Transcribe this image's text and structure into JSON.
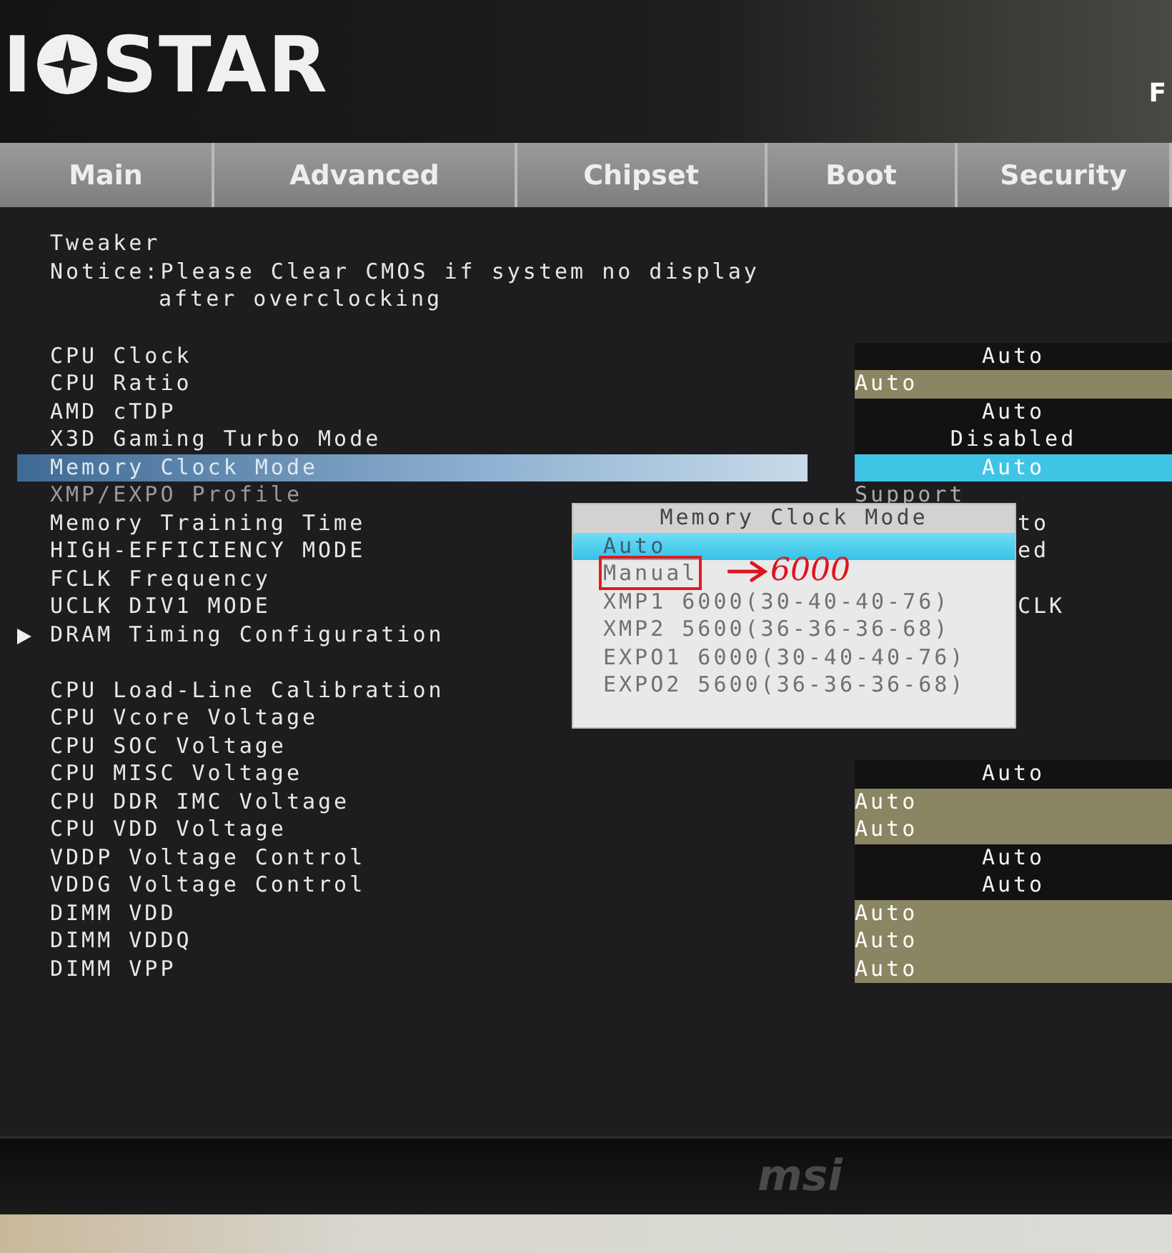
{
  "header": {
    "logo": {
      "before": "I",
      "after": "STAR"
    },
    "model": "F"
  },
  "tabs": [
    {
      "label": "Main",
      "selected": false
    },
    {
      "label": "Advanced",
      "selected": false
    },
    {
      "label": "Chipset",
      "selected": false
    },
    {
      "label": "Boot",
      "selected": false
    },
    {
      "label": "Security",
      "selected": false
    }
  ],
  "page": {
    "title": "Tweaker",
    "notice": "Notice:Please Clear CMOS if system no display",
    "notice_continued": "after overclocking"
  },
  "groups": [
    {
      "rows": [
        {
          "kind": "setting",
          "label": "CPU Clock",
          "selected": false,
          "disabled": false,
          "value": {
            "kind": "select",
            "text": "Auto"
          }
        },
        {
          "kind": "setting",
          "label": "CPU Ratio",
          "selected": false,
          "disabled": false,
          "value": {
            "kind": "input",
            "text": "Auto"
          }
        },
        {
          "kind": "setting",
          "label": "AMD cTDP",
          "selected": false,
          "disabled": false,
          "value": {
            "kind": "select",
            "text": "Auto"
          }
        },
        {
          "kind": "setting",
          "label": "X3D Gaming Turbo Mode",
          "selected": false,
          "disabled": false,
          "value": {
            "kind": "select",
            "text": "Disabled"
          }
        },
        {
          "kind": "setting",
          "label": "Memory Clock Mode",
          "selected": true,
          "disabled": false,
          "value": {
            "kind": "select",
            "text": "Auto"
          }
        },
        {
          "kind": "setting",
          "label": "XMP/EXPO Profile",
          "selected": false,
          "disabled": true,
          "value": {
            "kind": "text",
            "text": "Support"
          }
        },
        {
          "kind": "setting",
          "label": "Memory Training Time",
          "selected": false,
          "disabled": false,
          "value": {
            "kind": "partial",
            "text": "to"
          }
        },
        {
          "kind": "setting",
          "label": "HIGH-EFFICIENCY MODE",
          "selected": false,
          "disabled": false,
          "value": {
            "kind": "partial",
            "text": "ed"
          }
        },
        {
          "kind": "setting",
          "label": "FCLK Frequency",
          "selected": false,
          "disabled": false
        },
        {
          "kind": "setting",
          "label": "UCLK DIV1 MODE",
          "selected": false,
          "disabled": false,
          "value": {
            "kind": "partial",
            "text": "CLK"
          }
        },
        {
          "kind": "submenu",
          "label": "DRAM Timing Configuration",
          "selected": false,
          "disabled": false
        }
      ]
    },
    {
      "rows": [
        {
          "kind": "setting",
          "label": "CPU Load-Line Calibration",
          "selected": false,
          "disabled": false
        },
        {
          "kind": "setting",
          "label": "CPU Vcore Voltage",
          "selected": false,
          "disabled": false
        },
        {
          "kind": "setting",
          "label": "CPU SOC Voltage",
          "selected": false,
          "disabled": false
        },
        {
          "kind": "setting",
          "label": "CPU MISC Voltage",
          "selected": false,
          "disabled": false,
          "value": {
            "kind": "select",
            "text": "Auto"
          }
        },
        {
          "kind": "setting",
          "label": "CPU DDR IMC Voltage",
          "selected": false,
          "disabled": false,
          "value": {
            "kind": "input",
            "text": "Auto"
          }
        },
        {
          "kind": "setting",
          "label": "CPU VDD Voltage",
          "selected": false,
          "disabled": false,
          "value": {
            "kind": "input",
            "text": "Auto"
          }
        },
        {
          "kind": "setting",
          "label": "VDDP Voltage Control",
          "selected": false,
          "disabled": false,
          "value": {
            "kind": "select",
            "text": "Auto"
          }
        },
        {
          "kind": "setting",
          "label": "VDDG Voltage Control",
          "selected": false,
          "disabled": false,
          "value": {
            "kind": "select",
            "text": "Auto"
          }
        },
        {
          "kind": "setting",
          "label": "DIMM VDD",
          "selected": false,
          "disabled": false,
          "value": {
            "kind": "input",
            "text": "Auto"
          }
        },
        {
          "kind": "setting",
          "label": "DIMM VDDQ",
          "selected": false,
          "disabled": false,
          "value": {
            "kind": "input",
            "text": "Auto"
          }
        },
        {
          "kind": "setting",
          "label": "DIMM VPP",
          "selected": false,
          "disabled": false,
          "value": {
            "kind": "input",
            "text": "Auto"
          }
        }
      ]
    }
  ],
  "popup": {
    "title": "Memory Clock Mode",
    "options": [
      {
        "label": "Auto",
        "selected": true,
        "marked": false
      },
      {
        "label": "Manual",
        "selected": false,
        "marked": true
      },
      {
        "label": "XMP1 6000(30-40-40-76)",
        "selected": false,
        "marked": false
      },
      {
        "label": "XMP2 5600(36-36-36-68)",
        "selected": false,
        "marked": false
      },
      {
        "label": "EXPO1 6000(30-40-40-76)",
        "selected": false,
        "marked": false
      },
      {
        "label": "EXPO2 5600(36-36-36-68)",
        "selected": false,
        "marked": false
      }
    ],
    "annotation": "6000"
  },
  "bezel": {
    "logo": "msi"
  }
}
